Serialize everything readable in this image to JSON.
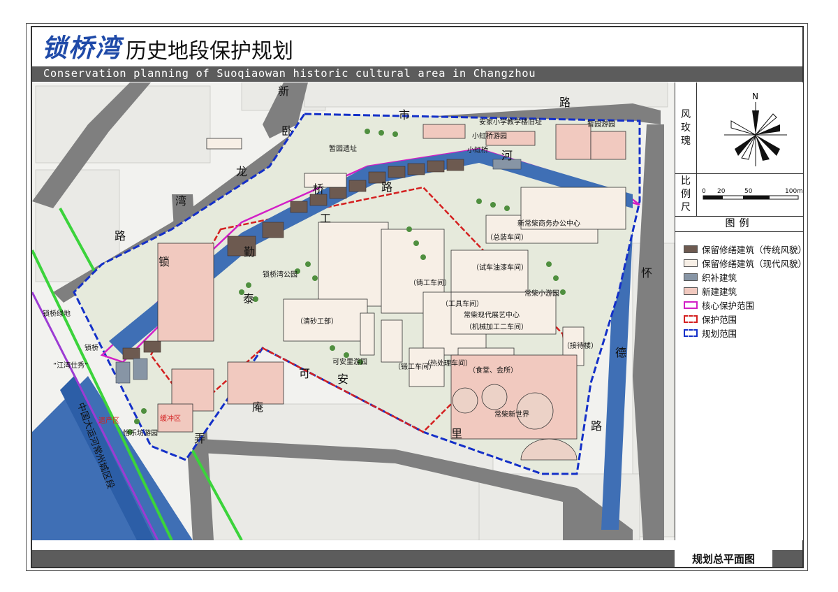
{
  "title": {
    "brand": "锁桥湾",
    "main": "历史地段保护规划"
  },
  "subtitle": "Conservation planning of Suoqiaowan historic cultural area in Changzhou",
  "sidebar": {
    "wind_rose_label": [
      "风",
      "玫",
      "瑰"
    ],
    "north": "N",
    "scale_label": [
      "比",
      "例",
      "尺"
    ],
    "scale_ticks": [
      "0",
      "20",
      "50",
      "100m"
    ],
    "legend_title": "图例",
    "legend": [
      {
        "label": "保留修缮建筑（传统风貌）",
        "color": "#6d5a50"
      },
      {
        "label": "保留修缮建筑（现代风貌）",
        "color": "#f7efe6"
      },
      {
        "label": "织补建筑",
        "color": "#8795a5"
      },
      {
        "label": "新建建筑",
        "color": "#f1c9bf"
      },
      {
        "label": "核心保护范围",
        "color": "#d21fc6"
      },
      {
        "label": "保护范围",
        "color": "#d42020"
      },
      {
        "label": "规划范围",
        "color": "#1430c8"
      }
    ]
  },
  "map_labels": {
    "road_xinshi": [
      "新",
      "市",
      "路"
    ],
    "road_wolong": [
      "卧",
      "龙",
      "湾",
      "路"
    ],
    "road_huaide": [
      "怀",
      "德",
      "路"
    ],
    "road_suoqin": [
      "锁",
      "勤",
      "泰"
    ],
    "road_ke_an": [
      "可",
      "安",
      "里"
    ],
    "road_gongyan": [
      "庵",
      "弄"
    ],
    "road_qiaogong": [
      "桥",
      "工",
      "路"
    ],
    "canal_he": "河",
    "grand_canal": "中国大运河常州城区段",
    "xiaohong_bridge": "小虹桥",
    "xiaohong_garden": "小虹桥游园",
    "anjia_school": "安家小学教学楼旧址",
    "zanyuan": "暂园游园",
    "zanyuan2": "暂园遗址",
    "suoqiao_park": "锁桥湾公园",
    "suoqiao_pavilion": "锁桥绿地",
    "jiangyinggui": "“江湾仕秀”",
    "wanqiao": "锁桥",
    "fine_garden": "怡乐坊游园",
    "yichan_zone": "遗产区",
    "huanchong_zone": "缓冲区",
    "office_center": "新常柴商务办公中心",
    "assembly": "（总装车间）",
    "trial_workshop": "（试车油漆车间）",
    "cast_workshop": "（铸工车间）",
    "tool_workshop": "（工具车间）",
    "exhibit_center": "常柴现代展艺中心",
    "machine_workshop": "（机械加工二车间）",
    "sand_workshop": "（清砂工部）",
    "forging": "（锻工车间）",
    "heat_treat": "（热处理车间）",
    "canteen": "（食堂、会所）",
    "new_world": "常柴新世界",
    "changchai_garden": "常柴小游园",
    "kean_garden": "可安里游园",
    "guest": "（接待楼）"
  }
}
